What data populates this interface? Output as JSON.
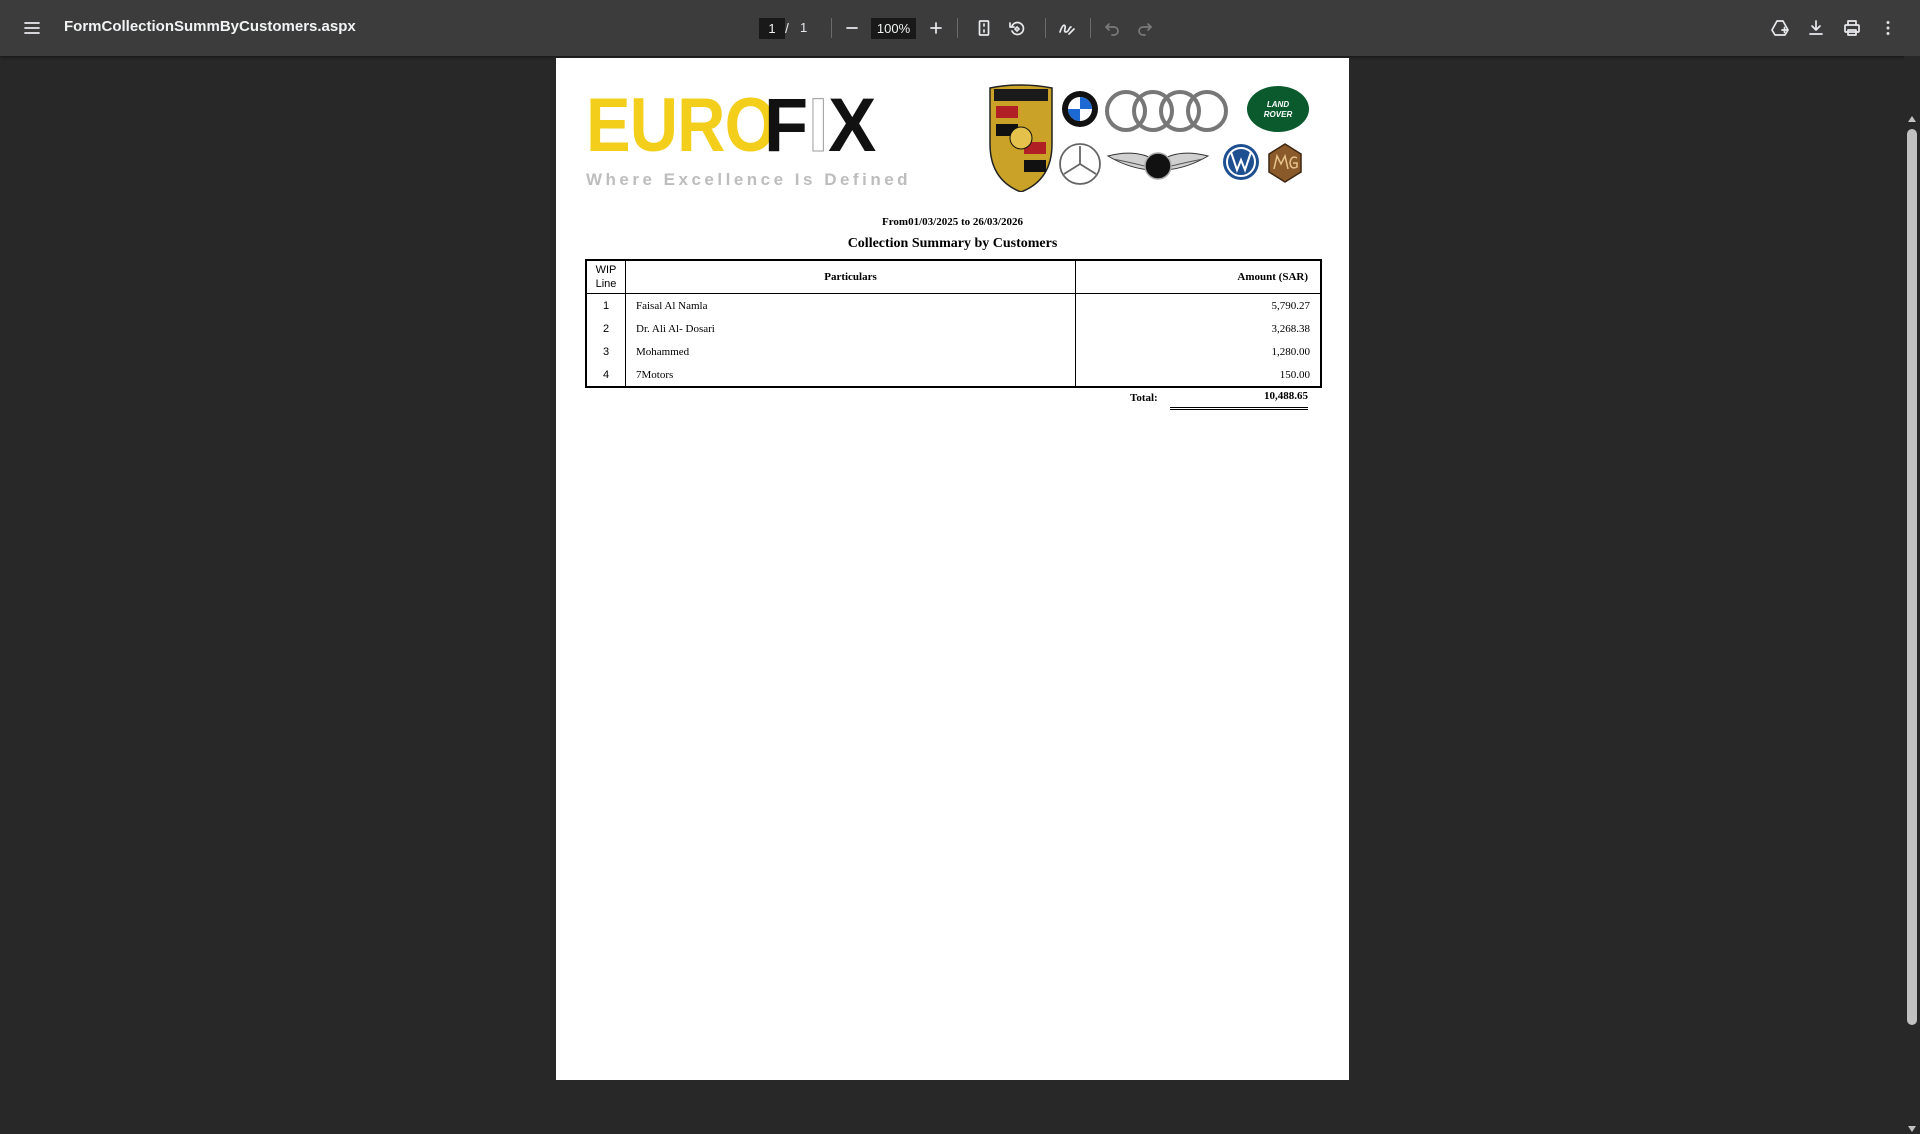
{
  "toolbar": {
    "title": "FormCollectionSummByCustomers.aspx",
    "page_current": "1",
    "page_separator": "/",
    "page_total": "1",
    "zoom": "100%",
    "icons": [
      "menu-icon",
      "zoom-out-icon",
      "zoom-in-icon",
      "fit-page-icon",
      "rotate-icon",
      "draw-icon",
      "undo-icon",
      "redo-icon",
      "save-to-drive-icon",
      "download-icon",
      "print-icon",
      "more-icon"
    ]
  },
  "report": {
    "logo_euro": "EURO",
    "logo_fix_f": "F",
    "logo_fix_i": "I",
    "logo_fix_x": "X",
    "tagline": "Where Excellence Is Defined",
    "brand_logos": [
      "Porsche",
      "BMW",
      "Audi",
      "Land Rover",
      "Mercedes-Benz",
      "Bentley",
      "Volkswagen",
      "MG"
    ],
    "date_range": "From01/03/2025 to 26/03/2026",
    "title": "Collection Summary by Customers",
    "columns": {
      "wip_line_1": "WIP",
      "wip_line_2": "Line",
      "particulars": "Particulars",
      "amount": "Amount (SAR)"
    },
    "rows": [
      {
        "line": "1",
        "particulars": "Faisal Al Namla",
        "amount": "5,790.27"
      },
      {
        "line": "2",
        "particulars": "Dr. Ali Al- Dosari",
        "amount": "3,268.38"
      },
      {
        "line": "3",
        "particulars": "Mohammed",
        "amount": "1,280.00"
      },
      {
        "line": "4",
        "particulars": "7Motors",
        "amount": "150.00"
      }
    ],
    "total_label": "Total:",
    "total_value": "10,488.65"
  },
  "colors": {
    "toolbar_bg": "#3c3c3c",
    "viewer_bg": "#282828",
    "euro_yellow": "#f3cf1c",
    "land_rover_green": "#0b5a2e"
  }
}
